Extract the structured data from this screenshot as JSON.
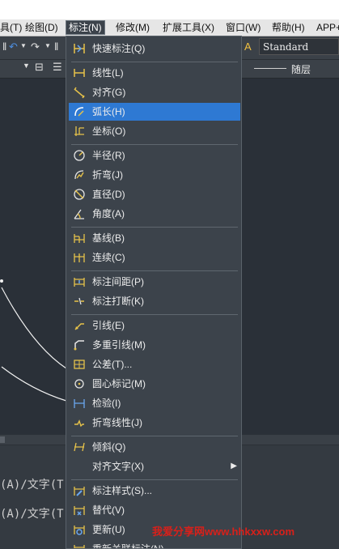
{
  "menubar": {
    "items": [
      "具(T)",
      "绘图(D)",
      "标注(N)",
      "修改(M)",
      "扩展工具(X)",
      "窗口(W)",
      "帮助(H)",
      "APP+"
    ]
  },
  "toolbar": {
    "text_style": "Standard",
    "layer_label": "随层"
  },
  "command": {
    "line1": "(A)/文字(T",
    "line2": "(A)/文字(T"
  },
  "menu": {
    "items": [
      {
        "label": "快速标注(Q)",
        "icon": "quick-dimension-icon"
      },
      {
        "label": "线性(L)",
        "icon": "linear-dimension-icon"
      },
      {
        "label": "对齐(G)",
        "icon": "aligned-dimension-icon"
      },
      {
        "label": "弧长(H)",
        "icon": "arc-length-icon"
      },
      {
        "label": "坐标(O)",
        "icon": "ordinate-icon"
      },
      {
        "label": "半径(R)",
        "icon": "radius-icon"
      },
      {
        "label": "折弯(J)",
        "icon": "jogged-icon"
      },
      {
        "label": "直径(D)",
        "icon": "diameter-icon"
      },
      {
        "label": "角度(A)",
        "icon": "angular-icon"
      },
      {
        "label": "基线(B)",
        "icon": "baseline-icon"
      },
      {
        "label": "连续(C)",
        "icon": "continue-icon"
      },
      {
        "label": "标注间距(P)",
        "icon": "dimension-space-icon"
      },
      {
        "label": "标注打断(K)",
        "icon": "dimension-break-icon"
      },
      {
        "label": "引线(E)",
        "icon": "leader-icon"
      },
      {
        "label": "多重引线(M)",
        "icon": "multileader-icon"
      },
      {
        "label": "公差(T)...",
        "icon": "tolerance-icon"
      },
      {
        "label": "圆心标记(M)",
        "icon": "center-mark-icon"
      },
      {
        "label": "检验(I)",
        "icon": "inspection-icon"
      },
      {
        "label": "折弯线性(J)",
        "icon": "jogged-linear-icon"
      },
      {
        "label": "倾斜(Q)",
        "icon": "oblique-icon"
      },
      {
        "label": "对齐文字(X)",
        "icon": ""
      },
      {
        "label": "标注样式(S)...",
        "icon": "dimension-style-icon"
      },
      {
        "label": "替代(V)",
        "icon": "override-icon"
      },
      {
        "label": "更新(U)",
        "icon": "update-icon"
      },
      {
        "label": "重新关联标注(N)",
        "icon": "reassociate-icon"
      }
    ],
    "highlighted": "弧长(H)",
    "highlight_color": "#2e79d3"
  },
  "watermark": "我爱分享网www.hhkxxw.com"
}
